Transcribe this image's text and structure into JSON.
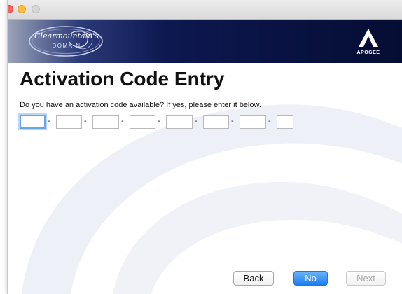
{
  "window": {
    "controls": [
      "close",
      "minimize",
      "maximize"
    ]
  },
  "banner": {
    "left_logo_line1": "Clearmountain's",
    "left_logo_line2": "DOMAIN",
    "right_logo_text": "APOGEE"
  },
  "page": {
    "title": "Activation Code Entry",
    "prompt": "Do you have an activation code available? If yes, please enter it below."
  },
  "code_fields": {
    "separator": "-",
    "values": [
      "",
      "",
      "",
      "",
      "",
      "",
      "",
      ""
    ],
    "focused_index": 0
  },
  "buttons": {
    "back": "Back",
    "no": "No",
    "next": "Next",
    "default_button": "no",
    "disabled_button": "next"
  },
  "colors": {
    "banner_dark": "#050d33",
    "default_button_blue": "#1b7ef0",
    "focus_ring": "#6aa3ef",
    "watermark": "#eceef6"
  }
}
